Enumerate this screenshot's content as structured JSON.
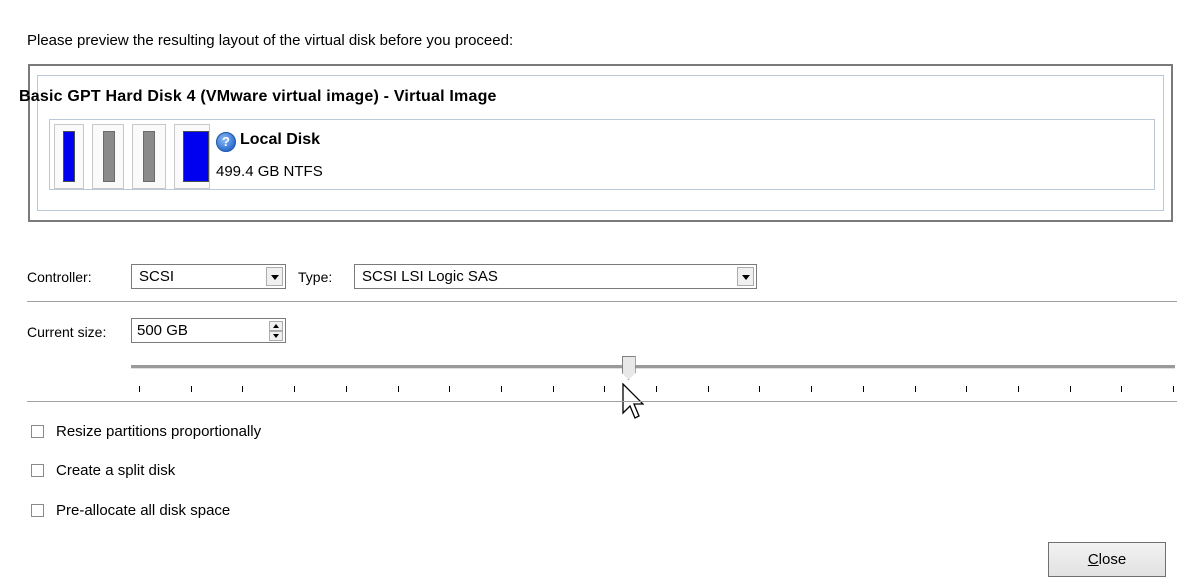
{
  "intro_text": "Please preview the resulting layout of the virtual disk before you proceed:",
  "disk": {
    "title": "Basic GPT Hard Disk 4 (VMware virtual image) - Virtual Image",
    "partition_label": "Local Disk",
    "partition_detail": "499.4 GB NTFS",
    "help_glyph": "?"
  },
  "controller": {
    "label": "Controller:",
    "value": "SCSI"
  },
  "type": {
    "label": "Type:",
    "value": "SCSI LSI Logic SAS"
  },
  "size": {
    "label": "Current size:",
    "value": "500 GB"
  },
  "slider": {
    "position_fraction": 0.47,
    "tick_count": 20
  },
  "options": [
    {
      "label": "Resize partitions proportionally",
      "checked": false
    },
    {
      "label": "Create a split disk",
      "checked": false
    },
    {
      "label": "Pre-allocate all disk space",
      "checked": false
    }
  ],
  "close_button": {
    "first": "C",
    "rest": "lose"
  },
  "colors": {
    "partition_blue": "#0000f0",
    "partition_gray": "#8a8a8a"
  }
}
